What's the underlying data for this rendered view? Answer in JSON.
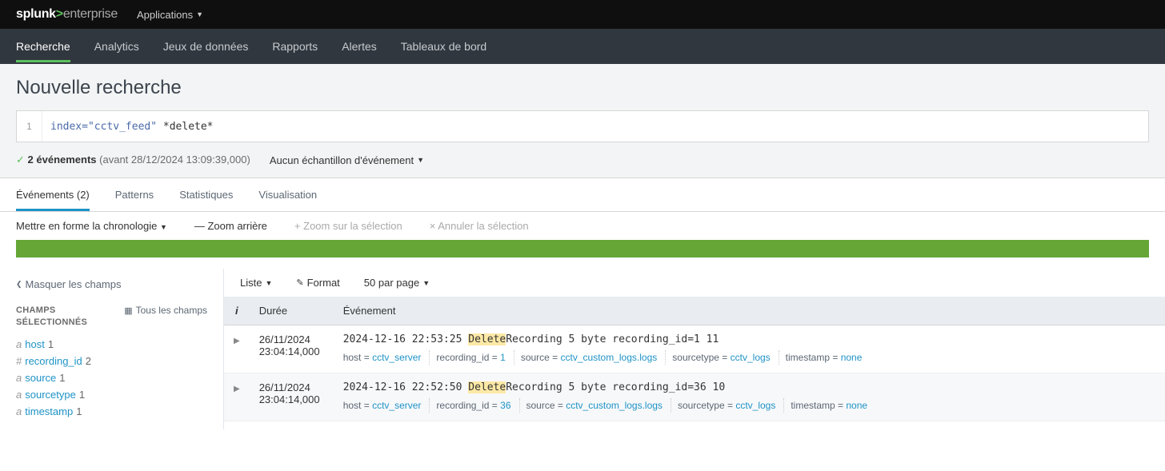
{
  "logo": {
    "brand": "splunk",
    "suffix": "enterprise"
  },
  "app_menu": "Applications",
  "nav": [
    "Recherche",
    "Analytics",
    "Jeux de données",
    "Rapports",
    "Alertes",
    "Tableaux de bord"
  ],
  "page_title": "Nouvelle recherche",
  "search": {
    "line": "1",
    "query_attr": "index=\"cctv_feed\"",
    "query_rest": " *delete*"
  },
  "status": {
    "count": "2 événements",
    "range": "(avant 28/12/2024 13:09:39,000)",
    "sample": "Aucun échantillon d'événement"
  },
  "tabs": [
    "Événements (2)",
    "Patterns",
    "Statistiques",
    "Visualisation"
  ],
  "timeline": {
    "format": "Mettre en forme la chronologie",
    "zoom_out": "Zoom arrière",
    "zoom_sel": "Zoom sur la sélection",
    "cancel": "Annuler la sélection"
  },
  "fields": {
    "hide": "Masquer les champs",
    "header": "CHAMPS SÉLECTIONNÉS",
    "all": "Tous les champs",
    "items": [
      {
        "type": "a",
        "name": "host",
        "count": "1"
      },
      {
        "type": "#",
        "name": "recording_id",
        "count": "2"
      },
      {
        "type": "a",
        "name": "source",
        "count": "1"
      },
      {
        "type": "a",
        "name": "sourcetype",
        "count": "1"
      },
      {
        "type": "a",
        "name": "timestamp",
        "count": "1"
      }
    ]
  },
  "view": {
    "list": "Liste",
    "format": "Format",
    "per_page": "50 par page"
  },
  "cols": {
    "i": "i",
    "time": "Durée",
    "event": "Événement"
  },
  "events": [
    {
      "date": "26/11/2024",
      "time": "23:04:14,000",
      "raw_pre": "2024-12-16 22:53:25 ",
      "raw_hl": "Delete",
      "raw_post": "Recording 5 byte recording_id=1 11",
      "tags": [
        {
          "k": "host",
          "v": "cctv_server"
        },
        {
          "k": "recording_id",
          "v": "1"
        },
        {
          "k": "source",
          "v": "cctv_custom_logs.logs"
        },
        {
          "k": "sourcetype",
          "v": "cctv_logs"
        },
        {
          "k": "timestamp",
          "v": "none"
        }
      ]
    },
    {
      "date": "26/11/2024",
      "time": "23:04:14,000",
      "raw_pre": "2024-12-16 22:52:50 ",
      "raw_hl": "Delete",
      "raw_post": "Recording 5 byte recording_id=36 10",
      "tags": [
        {
          "k": "host",
          "v": "cctv_server"
        },
        {
          "k": "recording_id",
          "v": "36"
        },
        {
          "k": "source",
          "v": "cctv_custom_logs.logs"
        },
        {
          "k": "sourcetype",
          "v": "cctv_logs"
        },
        {
          "k": "timestamp",
          "v": "none"
        }
      ]
    }
  ]
}
